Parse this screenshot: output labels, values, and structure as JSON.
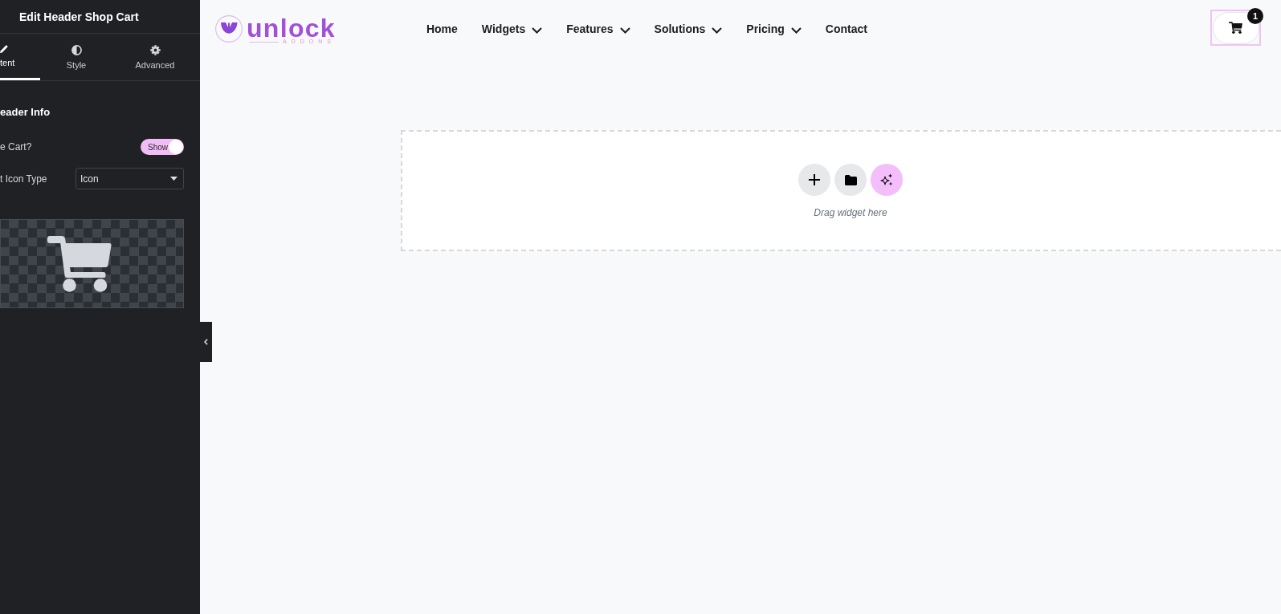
{
  "panel": {
    "title": "Edit Header Shop Cart",
    "tabs": [
      {
        "label": "tent",
        "selected": true
      },
      {
        "label": "Style",
        "selected": false
      },
      {
        "label": "Advanced",
        "selected": false
      }
    ],
    "section_title": "eader Info",
    "controls": [
      {
        "kind": "toggle",
        "label": "e Cart?",
        "on": true,
        "on_label": "Show"
      },
      {
        "kind": "select",
        "label": "t Icon Type",
        "value": "Icon"
      }
    ]
  },
  "header": {
    "logo": {
      "wordmark": "unlock",
      "tagline": "ADDONS"
    },
    "nav": [
      {
        "label": "Home",
        "dropdown": false
      },
      {
        "label": "Widgets",
        "dropdown": true
      },
      {
        "label": "Features",
        "dropdown": true
      },
      {
        "label": "Solutions",
        "dropdown": true
      },
      {
        "label": "Pricing",
        "dropdown": true
      },
      {
        "label": "Contact",
        "dropdown": false
      }
    ],
    "cart": {
      "count": "1",
      "selected": true
    }
  },
  "drop_zone": {
    "hint": "Drag widget here"
  }
}
